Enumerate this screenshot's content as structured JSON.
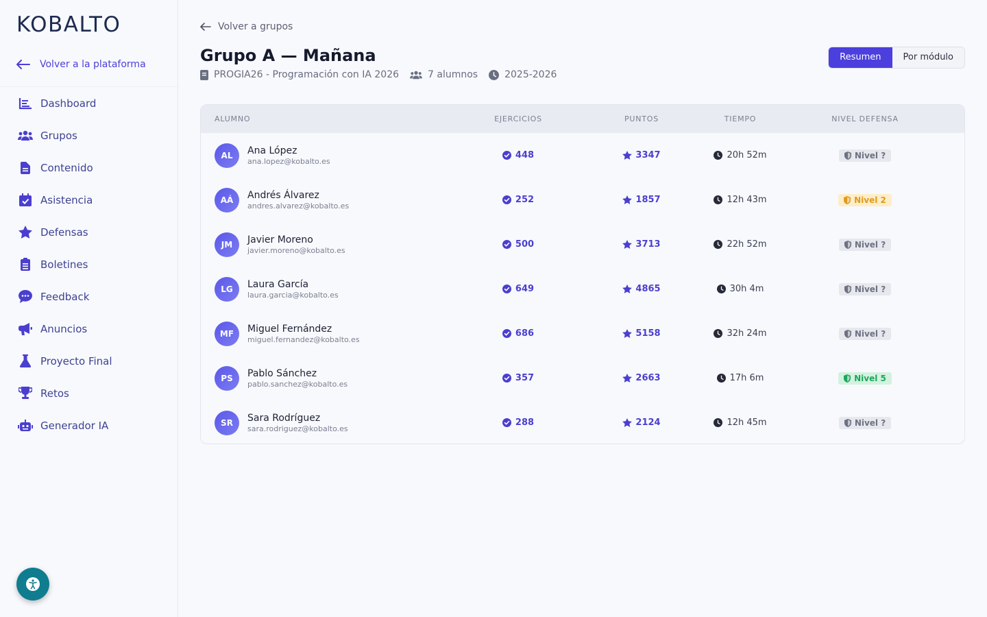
{
  "sidebar": {
    "logo": "KOBALTO",
    "back_label": "Volver a la plataforma",
    "items": [
      {
        "label": "Dashboard",
        "icon": "chart-bar-icon"
      },
      {
        "label": "Grupos",
        "icon": "users-icon"
      },
      {
        "label": "Contenido",
        "icon": "file-icon"
      },
      {
        "label": "Asistencia",
        "icon": "calendar-check-icon"
      },
      {
        "label": "Defensas",
        "icon": "star-icon"
      },
      {
        "label": "Boletines",
        "icon": "clipboard-icon"
      },
      {
        "label": "Feedback",
        "icon": "chat-icon"
      },
      {
        "label": "Anuncios",
        "icon": "megaphone-icon"
      },
      {
        "label": "Proyecto Final",
        "icon": "flask-icon"
      },
      {
        "label": "Retos",
        "icon": "trophy-icon"
      },
      {
        "label": "Generador IA",
        "icon": "robot-icon"
      }
    ]
  },
  "header": {
    "back_label": "Volver a grupos",
    "title": "Grupo A — Mañana",
    "course": "PROGIA26 - Programación con IA 2026",
    "students": "7 alumnos",
    "year": "2025-2026",
    "tabs": {
      "summary": "Resumen",
      "by_module": "Por módulo"
    }
  },
  "table": {
    "columns": [
      "ALUMNO",
      "EJERCICIOS",
      "PUNTOS",
      "TIEMPO",
      "NIVEL DEFENSA"
    ],
    "rows": [
      {
        "initials": "AL",
        "name": "Ana López",
        "email": "ana.lopez@kobalto.es",
        "ejercicios": "448",
        "puntos": "3347",
        "tiempo": "20h 52m",
        "nivel": "Nivel ?",
        "nivel_style": "gray"
      },
      {
        "initials": "AÁ",
        "name": "Andrés Álvarez",
        "email": "andres.alvarez@kobalto.es",
        "ejercicios": "252",
        "puntos": "1857",
        "tiempo": "12h 43m",
        "nivel": "Nivel 2",
        "nivel_style": "amber"
      },
      {
        "initials": "JM",
        "name": "Javier Moreno",
        "email": "javier.moreno@kobalto.es",
        "ejercicios": "500",
        "puntos": "3713",
        "tiempo": "22h 52m",
        "nivel": "Nivel ?",
        "nivel_style": "gray"
      },
      {
        "initials": "LG",
        "name": "Laura García",
        "email": "laura.garcia@kobalto.es",
        "ejercicios": "649",
        "puntos": "4865",
        "tiempo": "30h 4m",
        "nivel": "Nivel ?",
        "nivel_style": "gray"
      },
      {
        "initials": "MF",
        "name": "Miguel Fernández",
        "email": "miguel.fernandez@kobalto.es",
        "ejercicios": "686",
        "puntos": "5158",
        "tiempo": "32h 24m",
        "nivel": "Nivel ?",
        "nivel_style": "gray"
      },
      {
        "initials": "PS",
        "name": "Pablo Sánchez",
        "email": "pablo.sanchez@kobalto.es",
        "ejercicios": "357",
        "puntos": "2663",
        "tiempo": "17h 6m",
        "nivel": "Nivel 5",
        "nivel_style": "green"
      },
      {
        "initials": "SR",
        "name": "Sara Rodríguez",
        "email": "sara.rodriguez@kobalto.es",
        "ejercicios": "288",
        "puntos": "2124",
        "tiempo": "12h 45m",
        "nivel": "Nivel ?",
        "nivel_style": "gray"
      }
    ]
  },
  "colors": {
    "accent": "#4b3fdd",
    "sidebar_text": "#3d4291",
    "fab": "#0f7d8f"
  }
}
